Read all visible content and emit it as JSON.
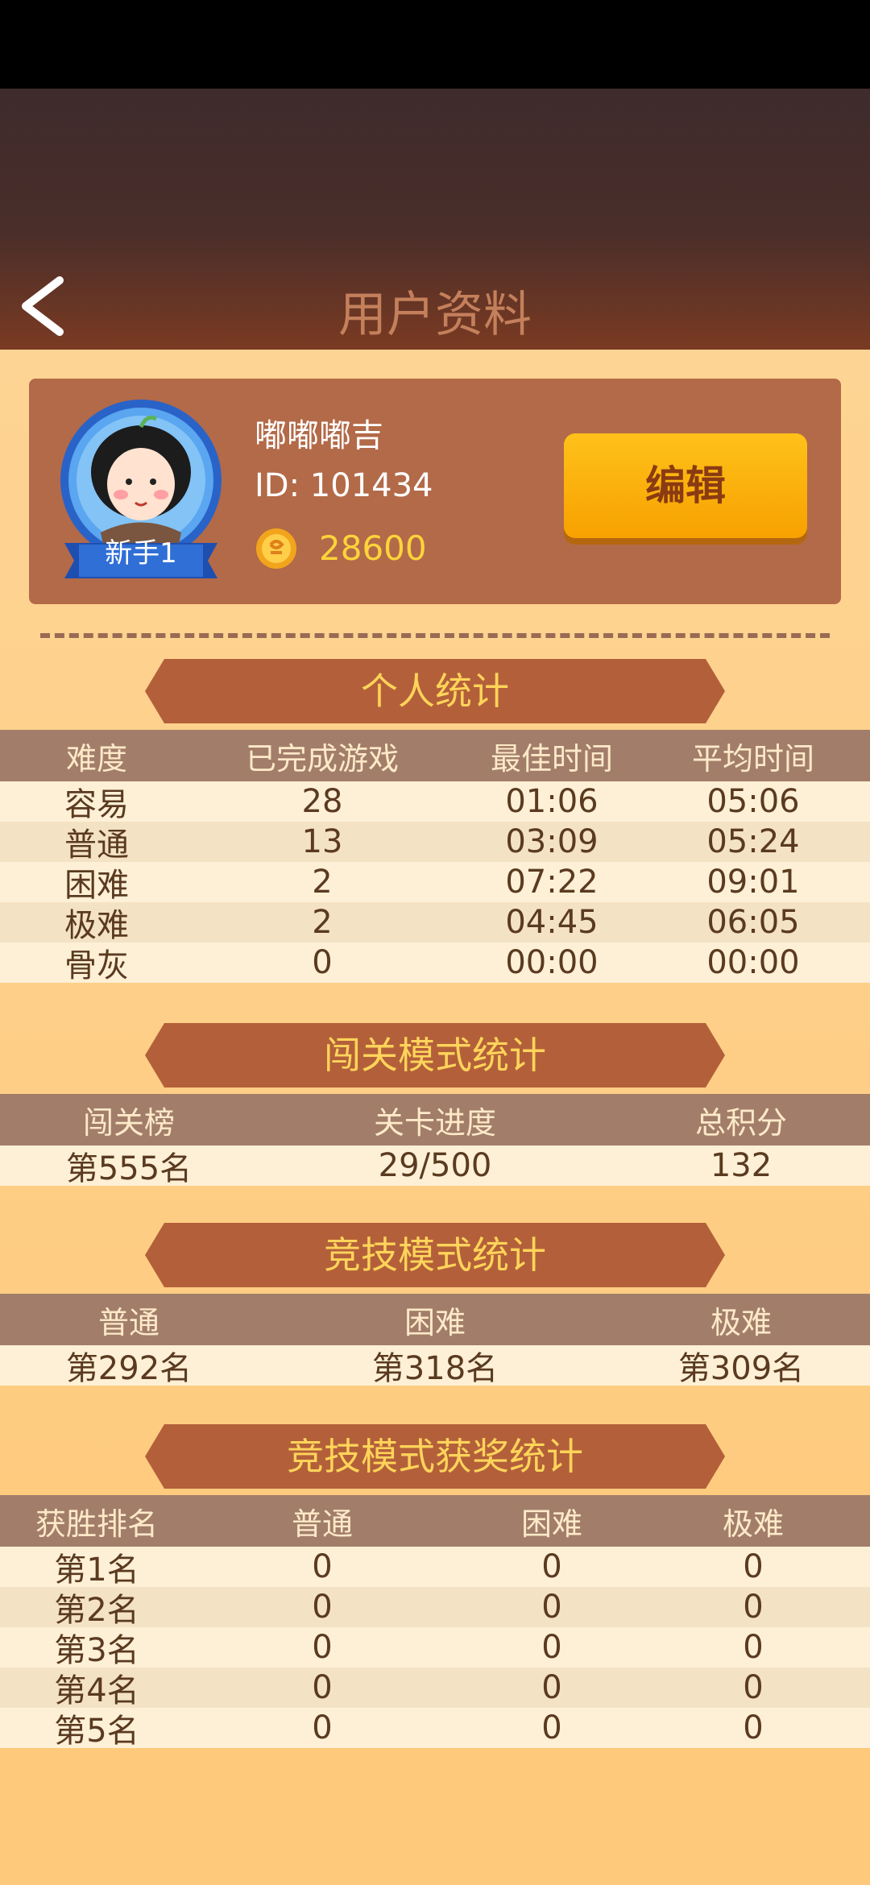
{
  "header": {
    "title": "用户资料"
  },
  "profile": {
    "name": "嘟嘟嘟吉",
    "id": "ID: 101434",
    "coins": "28600",
    "level_badge": "新手1",
    "edit_label": "编辑"
  },
  "personal": {
    "title": "个人统计",
    "headers": [
      "难度",
      "已完成游戏",
      "最佳时间",
      "平均时间"
    ],
    "rows": [
      [
        "容易",
        "28",
        "01:06",
        "05:06"
      ],
      [
        "普通",
        "13",
        "03:09",
        "05:24"
      ],
      [
        "困难",
        "2",
        "07:22",
        "09:01"
      ],
      [
        "极难",
        "2",
        "04:45",
        "06:05"
      ],
      [
        "骨灰",
        "0",
        "00:00",
        "00:00"
      ]
    ]
  },
  "challenge": {
    "title": "闯关模式统计",
    "headers": [
      "闯关榜",
      "关卡进度",
      "总积分"
    ],
    "rows": [
      [
        "第555名",
        "29/500",
        "132"
      ]
    ]
  },
  "competitive": {
    "title": "竞技模式统计",
    "headers": [
      "普通",
      "困难",
      "极难"
    ],
    "rows": [
      [
        "第292名",
        "第318名",
        "第309名"
      ]
    ]
  },
  "awards": {
    "title": "竞技模式获奖统计",
    "headers": [
      "获胜排名",
      "普通",
      "困难",
      "极难"
    ],
    "rows": [
      [
        "第1名",
        "0",
        "0",
        "0"
      ],
      [
        "第2名",
        "0",
        "0",
        "0"
      ],
      [
        "第3名",
        "0",
        "0",
        "0"
      ],
      [
        "第4名",
        "0",
        "0",
        "0"
      ],
      [
        "第5名",
        "0",
        "0",
        "0"
      ]
    ]
  },
  "icons": {
    "back": "chevron-left-icon",
    "coin": "coin-icon",
    "avatar": "avatar-icon"
  }
}
